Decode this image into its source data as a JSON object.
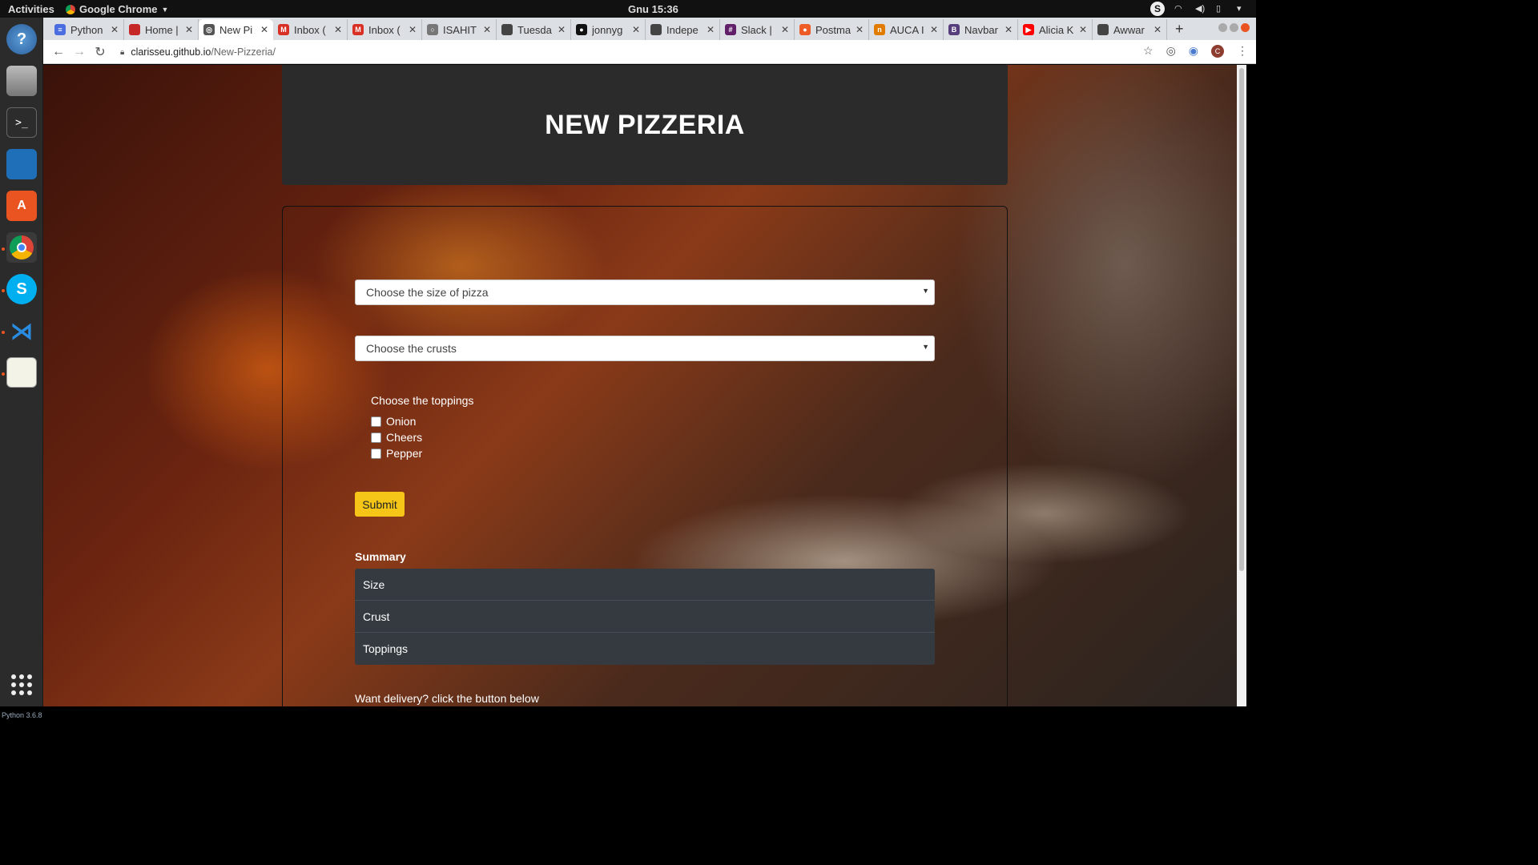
{
  "topbar": {
    "activities": "Activities",
    "app_name": "Google Chrome",
    "clock": "Gnu 15:36",
    "tray_s": "S"
  },
  "dock": {
    "label": "Python 3.6.8"
  },
  "tabs": [
    {
      "label": "Python",
      "color": "#4a6ee0",
      "glyph": "≡"
    },
    {
      "label": "Home |",
      "color": "#c62828",
      "glyph": ""
    },
    {
      "label": "New Pi",
      "color": "#555555",
      "glyph": "◎"
    },
    {
      "label": "Inbox (",
      "color": "#d93025",
      "glyph": "M"
    },
    {
      "label": "Inbox (",
      "color": "#d93025",
      "glyph": "M"
    },
    {
      "label": "ISAHIT",
      "color": "#777777",
      "glyph": "○"
    },
    {
      "label": "Tuesda",
      "color": "#444444",
      "glyph": ""
    },
    {
      "label": "jonnyg",
      "color": "#111111",
      "glyph": "●"
    },
    {
      "label": "Indepe",
      "color": "#444444",
      "glyph": ""
    },
    {
      "label": "Slack |",
      "color": "#611f69",
      "glyph": "#"
    },
    {
      "label": "Postma",
      "color": "#ef5b25",
      "glyph": "●"
    },
    {
      "label": "AUCA I",
      "color": "#e07b00",
      "glyph": "n"
    },
    {
      "label": "Navbar",
      "color": "#563d7c",
      "glyph": "B"
    },
    {
      "label": "Alicia K",
      "color": "#ff0000",
      "glyph": "▶"
    },
    {
      "label": "Awwar",
      "color": "#444444",
      "glyph": ""
    }
  ],
  "address": {
    "host": "clarisseu.github.io",
    "path": "/New-Pizzeria/"
  },
  "profile_initial": "C",
  "page": {
    "title": "NEW PIZZERIA",
    "size_select": "Choose the size of pizza",
    "crust_select": "Choose the crusts",
    "toppings_title": "Choose the toppings",
    "toppings": [
      "Onion",
      "Cheers",
      "Pepper"
    ],
    "submit_label": "Submit",
    "summary_title": "Summary",
    "summary_items": [
      "Size",
      "Crust",
      "Toppings"
    ],
    "delivery_text": "Want delivery? click the button below"
  },
  "colors": {
    "header_bg": "#2b2b2b",
    "submit_bg": "#f5c518",
    "summary_bg": "#343a40",
    "ubuntu_orange": "#e95420"
  }
}
